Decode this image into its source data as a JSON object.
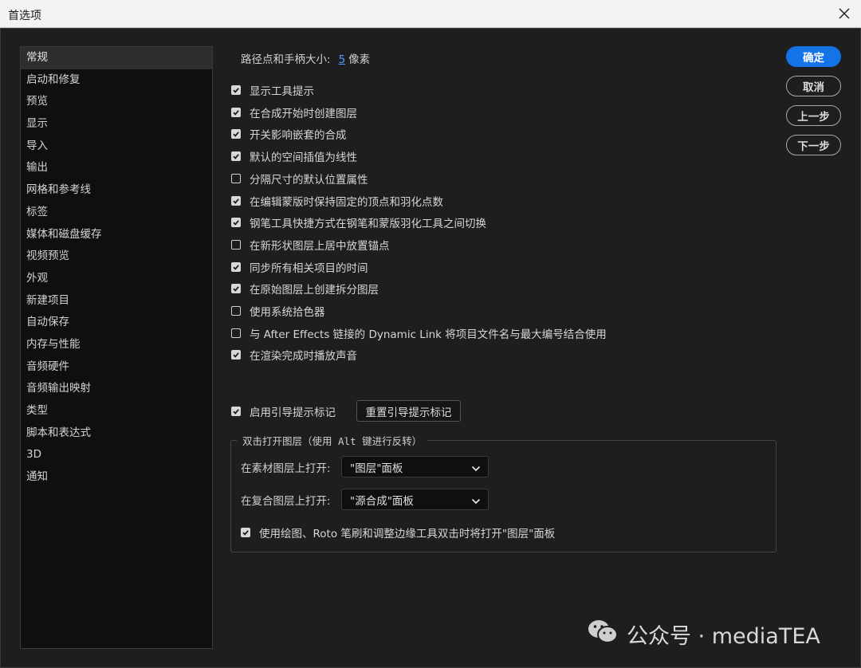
{
  "window": {
    "title": "首选项"
  },
  "sidebar": {
    "items": [
      {
        "label": "常规",
        "active": true
      },
      {
        "label": "启动和修复"
      },
      {
        "label": "预览"
      },
      {
        "label": "显示"
      },
      {
        "label": "导入"
      },
      {
        "label": "输出"
      },
      {
        "label": "网格和参考线"
      },
      {
        "label": "标签"
      },
      {
        "label": "媒体和磁盘缓存"
      },
      {
        "label": "视频预览"
      },
      {
        "label": "外观"
      },
      {
        "label": "新建项目"
      },
      {
        "label": "自动保存"
      },
      {
        "label": "内存与性能"
      },
      {
        "label": "音频硬件"
      },
      {
        "label": "音频输出映射"
      },
      {
        "label": "类型"
      },
      {
        "label": "脚本和表达式"
      },
      {
        "label": "3D"
      },
      {
        "label": "通知"
      }
    ]
  },
  "general": {
    "path_size_label": "路径点和手柄大小:",
    "path_size_value": "5",
    "path_size_unit": "像素",
    "options": [
      {
        "label": "显示工具提示",
        "checked": true
      },
      {
        "label": "在合成开始时创建图层",
        "checked": true
      },
      {
        "label": "开关影响嵌套的合成",
        "checked": true
      },
      {
        "label": "默认的空间插值为线性",
        "checked": true
      },
      {
        "label": "分隔尺寸的默认位置属性",
        "checked": false
      },
      {
        "label": "在编辑蒙版时保持固定的顶点和羽化点数",
        "checked": true
      },
      {
        "label": "钢笔工具快捷方式在钢笔和蒙版羽化工具之间切换",
        "checked": true
      },
      {
        "label": "在新形状图层上居中放置锚点",
        "checked": false
      },
      {
        "label": "同步所有相关项目的时间",
        "checked": true
      },
      {
        "label": "在原始图层上创建拆分图层",
        "checked": true
      },
      {
        "label": "使用系统拾色器",
        "checked": false
      },
      {
        "label": "与 After Effects 链接的 Dynamic Link 将项目文件名与最大编号结合使用",
        "checked": false
      },
      {
        "label": "在渲染完成时播放声音",
        "checked": true
      }
    ],
    "guide_hints": {
      "label": "启用引导提示标记",
      "checked": true
    },
    "reset_button": "重置引导提示标记",
    "double_click_group": {
      "legend": "双击打开图层（使用 Alt 键进行反转）",
      "footage_label": "在素材图层上打开:",
      "footage_value": "\"图层\"面板",
      "comp_label": "在复合图层上打开:",
      "comp_value": "\"源合成\"面板",
      "paint_option": {
        "label": "使用绘图、Roto 笔刷和调整边缘工具双击时将打开\"图层\"面板",
        "checked": true
      }
    }
  },
  "buttons": {
    "ok": "确定",
    "cancel": "取消",
    "prev": "上一步",
    "next": "下一步"
  },
  "watermark": {
    "text": "公众号 · mediaTEA"
  },
  "colors": {
    "accent": "#1473e6",
    "link": "#4f9bff",
    "background": "#1e1e1e"
  }
}
